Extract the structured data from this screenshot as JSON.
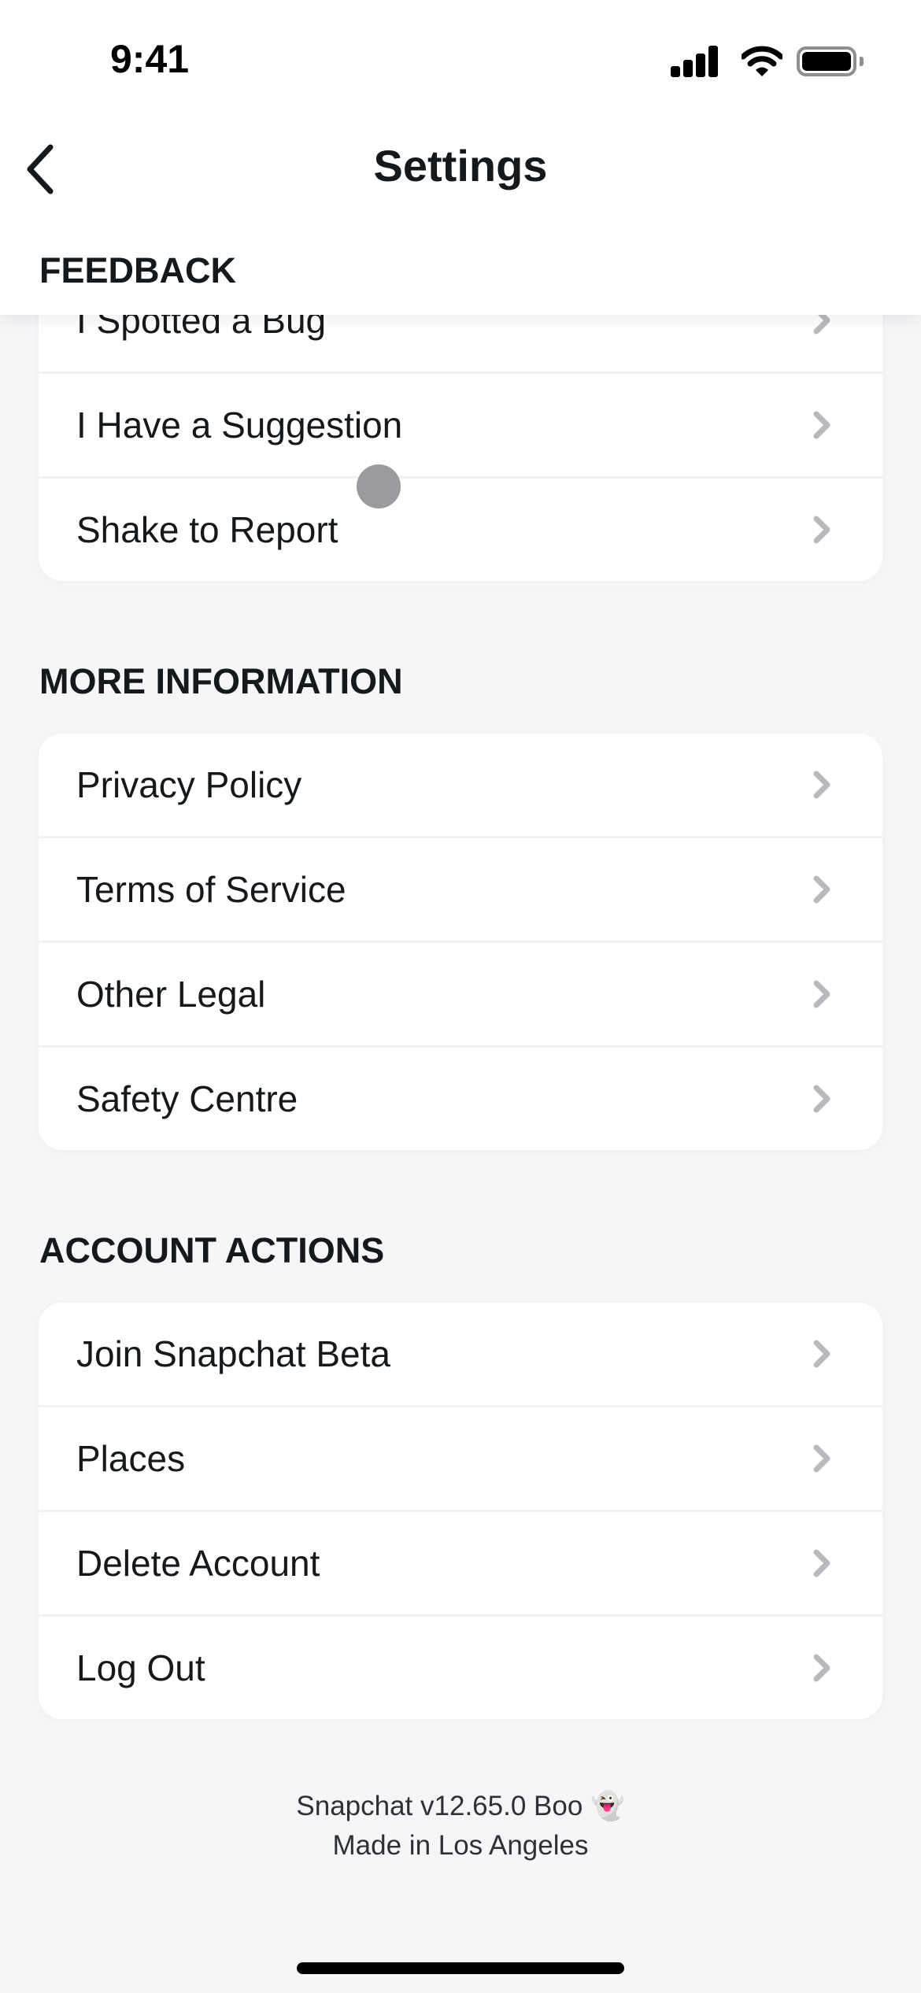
{
  "status_bar": {
    "time": "9:41",
    "icons": [
      "cellular-signal-icon",
      "wifi-icon",
      "battery-icon"
    ]
  },
  "nav": {
    "title": "Settings",
    "back_icon": "chevron-left-icon"
  },
  "sections": [
    {
      "header": "FEEDBACK",
      "items": [
        {
          "label": "I Spotted a Bug"
        },
        {
          "label": "I Have a Suggestion"
        },
        {
          "label": "Shake to Report"
        }
      ]
    },
    {
      "header": "MORE INFORMATION",
      "items": [
        {
          "label": "Privacy Policy"
        },
        {
          "label": "Terms of Service"
        },
        {
          "label": "Other Legal"
        },
        {
          "label": "Safety Centre"
        }
      ]
    },
    {
      "header": "ACCOUNT ACTIONS",
      "items": [
        {
          "label": "Join Snapchat Beta"
        },
        {
          "label": "Places"
        },
        {
          "label": "Delete Account"
        },
        {
          "label": "Log Out"
        }
      ]
    }
  ],
  "footer": {
    "version": "Snapchat v12.65.0 Boo 👻",
    "tagline": "Made in Los Angeles"
  },
  "colors": {
    "background": "#f6f6f9",
    "card": "#ffffff",
    "text": "#16191c",
    "chevron": "#b8b8bf",
    "separator": "#f1f1f4"
  }
}
